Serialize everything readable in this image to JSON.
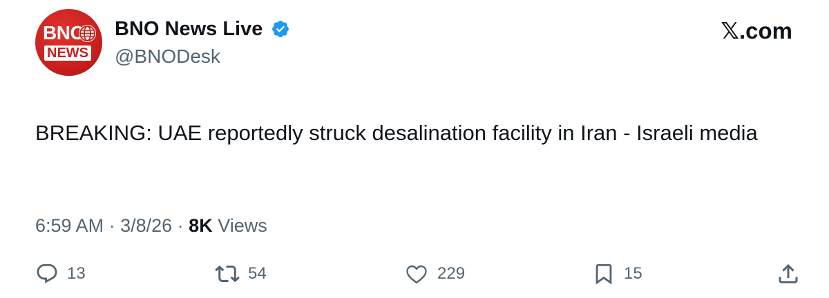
{
  "author": {
    "avatar_top": "BNO",
    "avatar_bottom": "NEWS",
    "display_name": "BNO News Live",
    "handle": "@BNODesk",
    "verified": true
  },
  "brand": {
    "site": "𝕏.com"
  },
  "tweet": {
    "text": "BREAKING: UAE reportedly struck desalination facility in Iran - Israeli media",
    "time": "6:59 AM",
    "date": "3/8/26",
    "views_count": "8K",
    "views_label": "Views"
  },
  "actions": {
    "replies": "13",
    "reposts": "54",
    "likes": "229",
    "bookmarks": "15"
  },
  "colors": {
    "avatar_red": "#c8201c",
    "verified_blue": "#1d9bf0",
    "secondary_text": "#536471",
    "primary_text": "#0f1419"
  },
  "icons": [
    "reply-icon",
    "repost-icon",
    "like-icon",
    "bookmark-icon",
    "share-icon",
    "verified-badge-icon",
    "globe-icon"
  ]
}
